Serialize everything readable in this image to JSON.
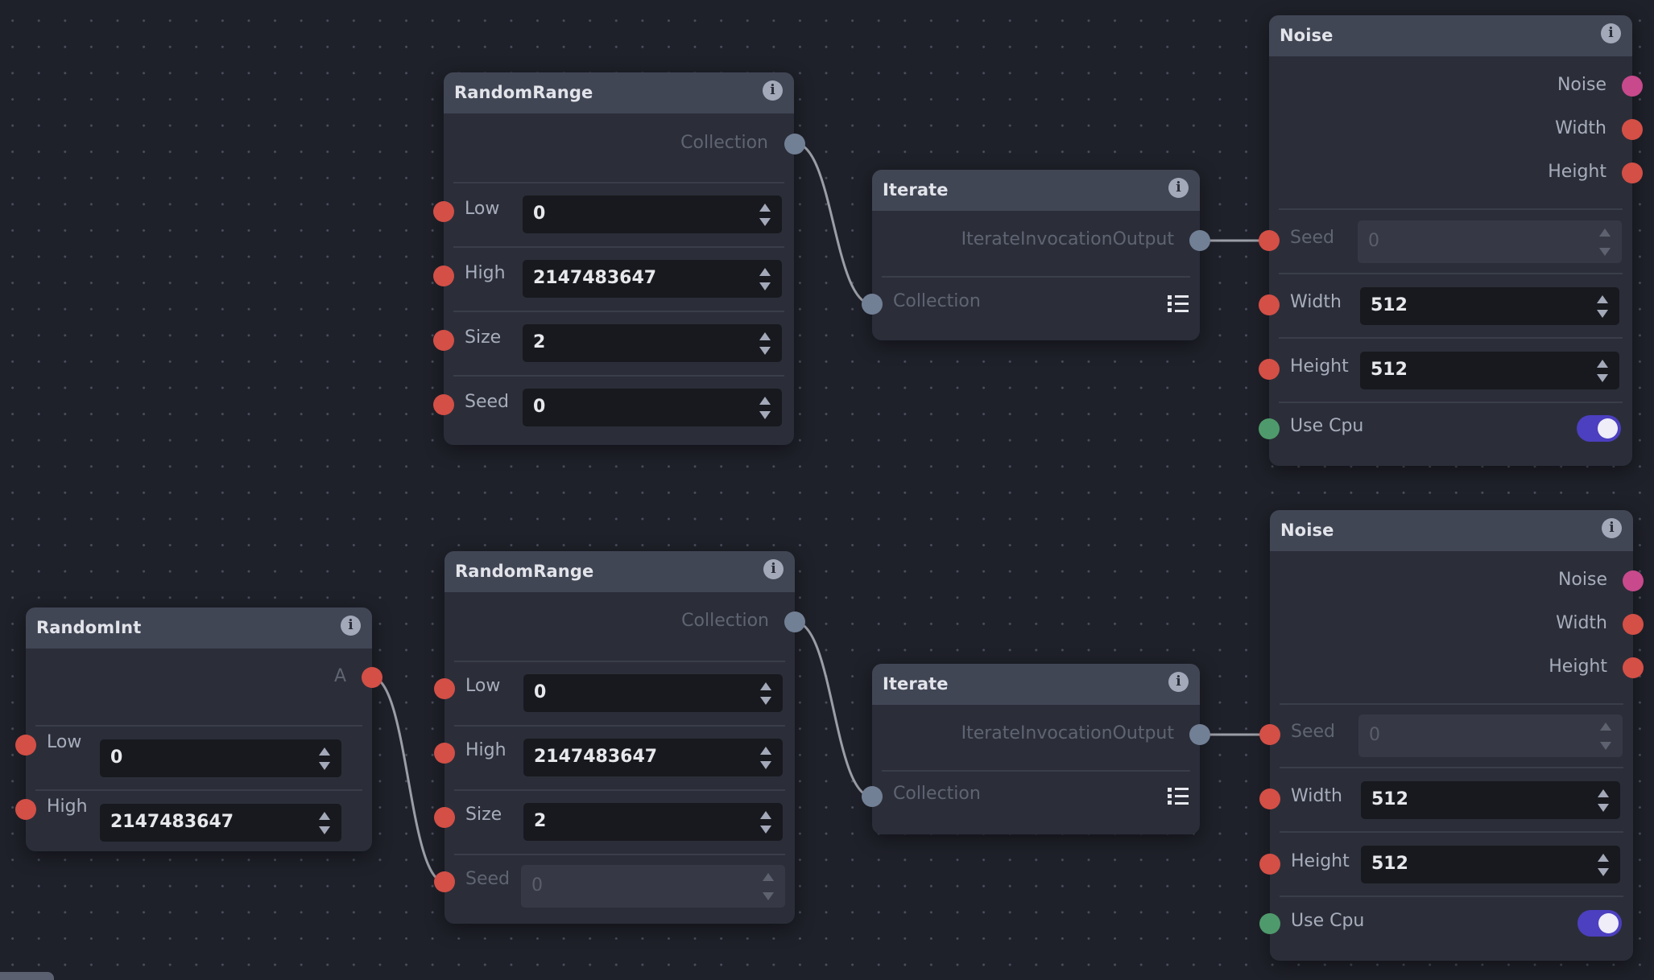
{
  "canvas": {
    "background": "#1f212a"
  },
  "colors": {
    "integer_handle": "#d44f46",
    "collection_handle": "#728096",
    "image_handle": "#c8498c",
    "boolean_handle": "#4f9a6c",
    "toggle_on": "#4c3fc0"
  },
  "nodes": {
    "random_range_1": {
      "title": "RandomRange",
      "info_icon": "info-icon",
      "outputs": [
        {
          "label": "Collection"
        }
      ],
      "inputs": [
        {
          "label": "Low",
          "value": "0",
          "disabled": false
        },
        {
          "label": "High",
          "value": "2147483647",
          "disabled": false
        },
        {
          "label": "Size",
          "value": "2",
          "disabled": false
        },
        {
          "label": "Seed",
          "value": "0",
          "disabled": false
        }
      ]
    },
    "iterate_1": {
      "title": "Iterate",
      "info_icon": "info-icon",
      "outputs": [
        {
          "label": "IterateInvocationOutput"
        }
      ],
      "inputs": [
        {
          "label": "Collection",
          "icon": "list-icon"
        }
      ]
    },
    "noise_1": {
      "title": "Noise",
      "info_icon": "info-icon",
      "outputs": [
        {
          "label": "Noise"
        },
        {
          "label": "Width"
        },
        {
          "label": "Height"
        }
      ],
      "inputs": [
        {
          "label": "Seed",
          "value": "0",
          "disabled": true
        },
        {
          "label": "Width",
          "value": "512",
          "disabled": false
        },
        {
          "label": "Height",
          "value": "512",
          "disabled": false
        },
        {
          "label": "Use Cpu",
          "toggle": true
        }
      ]
    },
    "random_int": {
      "title": "RandomInt",
      "info_icon": "info-icon",
      "outputs": [
        {
          "label": "A"
        }
      ],
      "inputs": [
        {
          "label": "Low",
          "value": "0",
          "disabled": false
        },
        {
          "label": "High",
          "value": "2147483647",
          "disabled": false
        }
      ]
    },
    "random_range_2": {
      "title": "RandomRange",
      "info_icon": "info-icon",
      "outputs": [
        {
          "label": "Collection"
        }
      ],
      "inputs": [
        {
          "label": "Low",
          "value": "0",
          "disabled": false
        },
        {
          "label": "High",
          "value": "2147483647",
          "disabled": false
        },
        {
          "label": "Size",
          "value": "2",
          "disabled": false
        },
        {
          "label": "Seed",
          "value": "0",
          "disabled": true
        }
      ]
    },
    "iterate_2": {
      "title": "Iterate",
      "info_icon": "info-icon",
      "outputs": [
        {
          "label": "IterateInvocationOutput"
        }
      ],
      "inputs": [
        {
          "label": "Collection",
          "icon": "list-icon"
        }
      ]
    },
    "noise_2": {
      "title": "Noise",
      "info_icon": "info-icon",
      "outputs": [
        {
          "label": "Noise"
        },
        {
          "label": "Width"
        },
        {
          "label": "Height"
        }
      ],
      "inputs": [
        {
          "label": "Seed",
          "value": "0",
          "disabled": true
        },
        {
          "label": "Width",
          "value": "512",
          "disabled": false
        },
        {
          "label": "Height",
          "value": "512",
          "disabled": false
        },
        {
          "label": "Use Cpu",
          "toggle": true
        }
      ]
    }
  },
  "edges": [
    {
      "from": "random_range_1.Collection",
      "to": "iterate_1.Collection"
    },
    {
      "from": "iterate_1.IterateInvocationOutput",
      "to": "noise_1.Seed"
    },
    {
      "from": "random_int.A",
      "to": "random_range_2.Seed"
    },
    {
      "from": "random_range_2.Collection",
      "to": "iterate_2.Collection"
    },
    {
      "from": "iterate_2.IterateInvocationOutput",
      "to": "noise_2.Seed"
    }
  ]
}
